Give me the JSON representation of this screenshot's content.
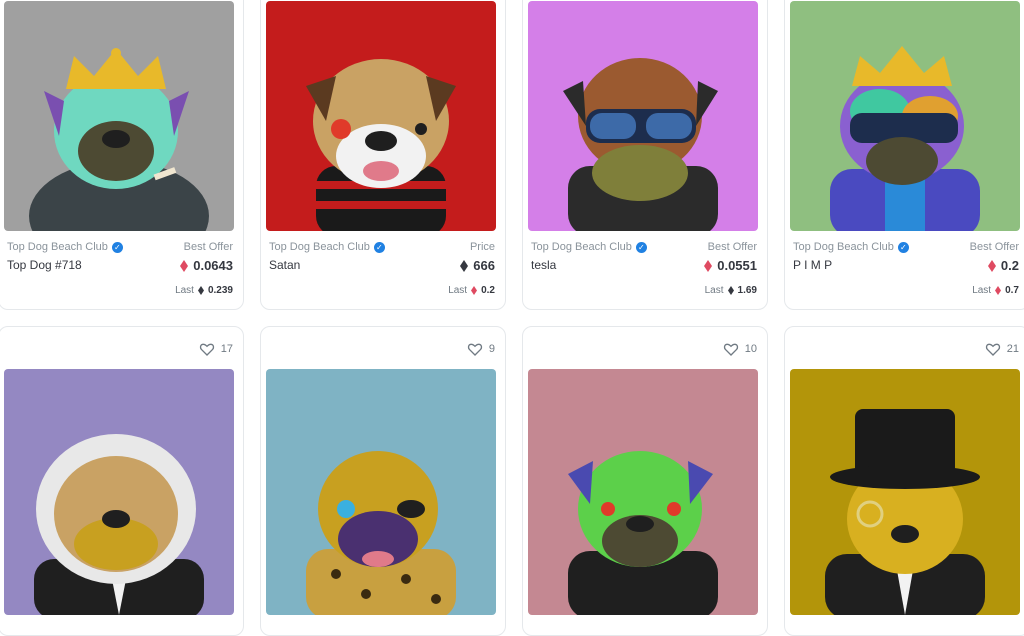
{
  "colors": {
    "weth": "#df4a61",
    "eth": "#353840",
    "verified": "#2081e2"
  },
  "listings": [
    {
      "collection": "Top Dog Beach Club",
      "name": "Top Dog #718",
      "price_label": "Best Offer",
      "price": "0.0643",
      "price_currency": "weth",
      "last_label": "Last",
      "last_price": "0.239",
      "last_currency": "eth",
      "bg": "#a0a0a0"
    },
    {
      "collection": "Top Dog Beach Club",
      "name": "Satan",
      "price_label": "Price",
      "price": "666",
      "price_currency": "eth",
      "last_label": "Last",
      "last_price": "0.2",
      "last_currency": "weth",
      "bg": "#c41c1c"
    },
    {
      "collection": "Top Dog Beach Club",
      "name": "tesla",
      "price_label": "Best Offer",
      "price": "0.0551",
      "price_currency": "weth",
      "last_label": "Last",
      "last_price": "1.69",
      "last_currency": "eth",
      "bg": "#d47fe8"
    },
    {
      "collection": "Top Dog Beach Club",
      "name": "P I M P",
      "price_label": "Best Offer",
      "price": "0.2",
      "price_currency": "weth",
      "last_label": "Last",
      "last_price": "0.7",
      "last_currency": "weth",
      "bg": "#8fbf80"
    }
  ],
  "row2": [
    {
      "favorites": "17",
      "bg": "#9488c2"
    },
    {
      "favorites": "9",
      "bg": "#7fb3c4"
    },
    {
      "favorites": "10",
      "bg": "#c48892"
    },
    {
      "favorites": "21",
      "bg": "#b3950a"
    }
  ]
}
